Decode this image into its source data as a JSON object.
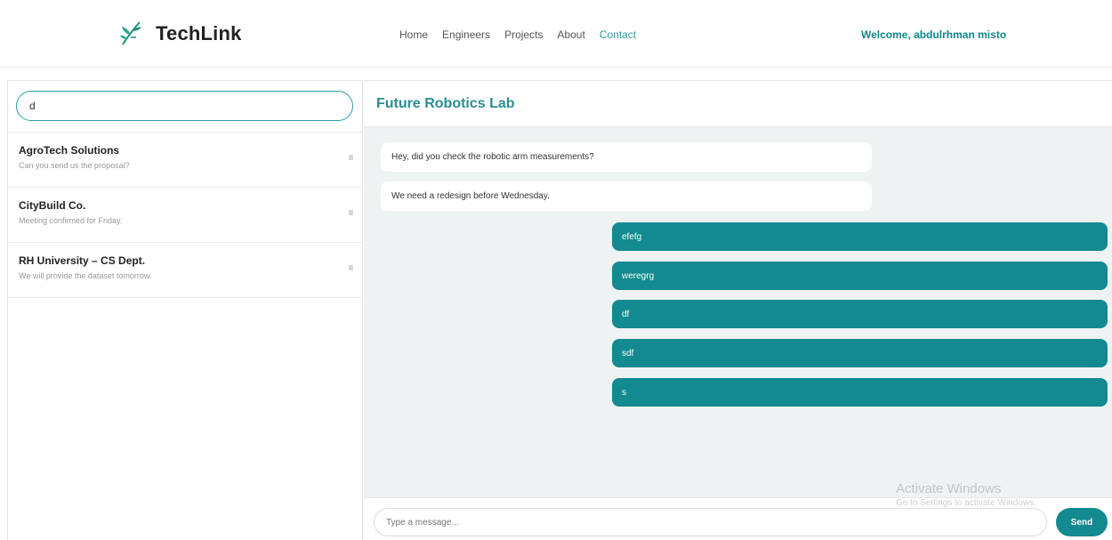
{
  "header": {
    "logo_text": "TechLink",
    "nav": [
      "Home",
      "Engineers",
      "Projects",
      "About",
      "Contact"
    ],
    "active_nav": "Contact",
    "welcome": "Welcome, abdulrhman misto"
  },
  "sidebar": {
    "search_value": "d",
    "conversations": [
      {
        "name": "AgroTech Solutions",
        "preview": "Can you send us the proposal?"
      },
      {
        "name": "CityBuild Co.",
        "preview": "Meeting confirmed for Friday."
      },
      {
        "name": "RH University – CS Dept.",
        "preview": "We will provide the dataset tomorrow."
      }
    ]
  },
  "chat": {
    "title": "Future Robotics Lab",
    "messages": [
      {
        "direction": "in",
        "text": "Hey, did you check the robotic arm measurements?"
      },
      {
        "direction": "in",
        "text": "We need a redesign before Wednesday."
      },
      {
        "direction": "out",
        "text": "efefg"
      },
      {
        "direction": "out",
        "text": "weregrg"
      },
      {
        "direction": "out",
        "text": "df"
      },
      {
        "direction": "out",
        "text": "sdf"
      },
      {
        "direction": "out",
        "text": "s"
      }
    ],
    "input_placeholder": "Type a message...",
    "send_label": "Send"
  },
  "overlay": {
    "activate_title": "Activate Windows",
    "activate_sub": "Go to Settings to activate Windows."
  },
  "colors": {
    "accent": "#138a8f",
    "title": "#2a8d93",
    "chat_bg": "#eef2f3"
  },
  "icons": {
    "logo": "leaf-icon",
    "conversation": "conversation-icon"
  }
}
